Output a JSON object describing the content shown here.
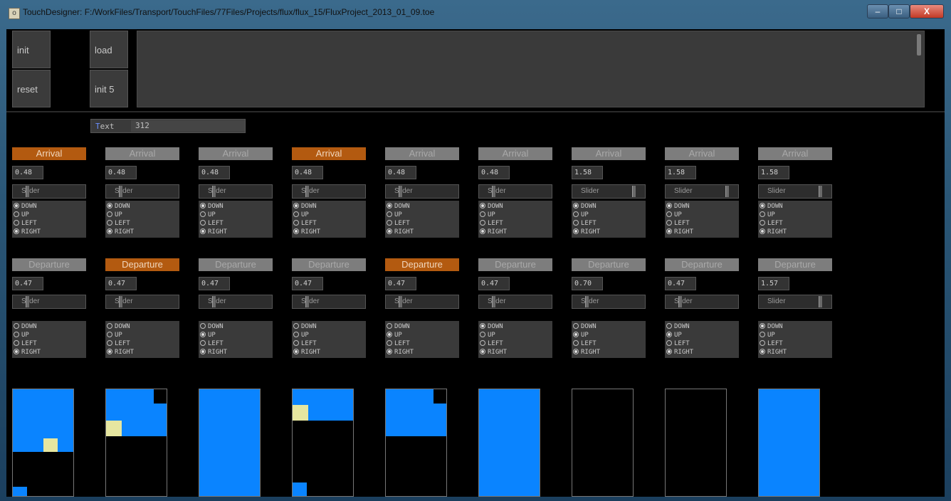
{
  "window": {
    "title": "TouchDesigner: F:/WorkFiles/Transport/TouchFiles/77Files/Projects/flux/flux_15/FluxProject_2013_01_09.toe",
    "icon": "touchdesigner-icon",
    "controls": {
      "minimize": "–",
      "maximize": "□",
      "close": "X"
    }
  },
  "toolbar": {
    "init_label": "init",
    "reset_label": "reset",
    "load_label": "load",
    "init5_label": "init 5"
  },
  "text_field": {
    "label_first": "T",
    "label_rest": "ext",
    "value": "312"
  },
  "colors": {
    "accent_on": "#b35a10",
    "grid_blue": "#0a84ff",
    "grid_yellow": "#e6e6a0"
  },
  "radio_options": [
    "DOWN",
    "UP",
    "LEFT",
    "RIGHT"
  ],
  "columns": [
    {
      "arrival": {
        "label": "Arrival",
        "active": true,
        "value": "0.48",
        "slider": "Slider",
        "selected": [
          "DOWN",
          "RIGHT"
        ]
      },
      "departure": {
        "label": "Departure",
        "active": false,
        "value": "0.47",
        "slider": "Slider",
        "selected": [
          "RIGHT"
        ]
      }
    },
    {
      "arrival": {
        "label": "Arrival",
        "active": false,
        "value": "0.48",
        "slider": "Slider",
        "selected": [
          "DOWN",
          "RIGHT"
        ]
      },
      "departure": {
        "label": "Departure",
        "active": true,
        "value": "0.47",
        "slider": "Slider",
        "selected": [
          "RIGHT"
        ]
      }
    },
    {
      "arrival": {
        "label": "Arrival",
        "active": false,
        "value": "0.48",
        "slider": "Slider",
        "selected": [
          "DOWN",
          "RIGHT"
        ]
      },
      "departure": {
        "label": "Departure",
        "active": false,
        "value": "0.47",
        "slider": "Slider",
        "selected": [
          "UP",
          "RIGHT"
        ]
      }
    },
    {
      "arrival": {
        "label": "Arrival",
        "active": true,
        "value": "0.48",
        "slider": "Slider",
        "selected": [
          "DOWN",
          "RIGHT"
        ]
      },
      "departure": {
        "label": "Departure",
        "active": false,
        "value": "0.47",
        "slider": "Slider",
        "selected": [
          "RIGHT"
        ]
      }
    },
    {
      "arrival": {
        "label": "Arrival",
        "active": false,
        "value": "0.48",
        "slider": "Slider",
        "selected": [
          "DOWN",
          "RIGHT"
        ]
      },
      "departure": {
        "label": "Departure",
        "active": true,
        "value": "0.47",
        "slider": "Slider",
        "selected": [
          "UP",
          "RIGHT"
        ]
      }
    },
    {
      "arrival": {
        "label": "Arrival",
        "active": false,
        "value": "0.48",
        "slider": "Slider",
        "selected": [
          "DOWN",
          "RIGHT"
        ]
      },
      "departure": {
        "label": "Departure",
        "active": false,
        "value": "0.47",
        "slider": "Slider",
        "selected": [
          "DOWN",
          "RIGHT"
        ]
      }
    },
    {
      "arrival": {
        "label": "Arrival",
        "active": false,
        "value": "1.58",
        "slider": "Slider",
        "selected": [
          "DOWN",
          "RIGHT"
        ]
      },
      "departure": {
        "label": "Departure",
        "active": false,
        "value": "0.70",
        "slider": "Slider",
        "selected": [
          "UP",
          "RIGHT"
        ]
      }
    },
    {
      "arrival": {
        "label": "Arrival",
        "active": false,
        "value": "1.58",
        "slider": "Slider",
        "selected": [
          "DOWN",
          "RIGHT"
        ]
      },
      "departure": {
        "label": "Departure",
        "active": false,
        "value": "0.47",
        "slider": "Slider",
        "selected": [
          "UP",
          "RIGHT"
        ]
      }
    },
    {
      "arrival": {
        "label": "Arrival",
        "active": false,
        "value": "1.58",
        "slider": "Slider",
        "selected": [
          "DOWN",
          "RIGHT"
        ]
      },
      "departure": {
        "label": "Departure",
        "active": false,
        "value": "1.57",
        "slider": "Slider",
        "selected": [
          "DOWN",
          "RIGHT"
        ]
      }
    }
  ]
}
